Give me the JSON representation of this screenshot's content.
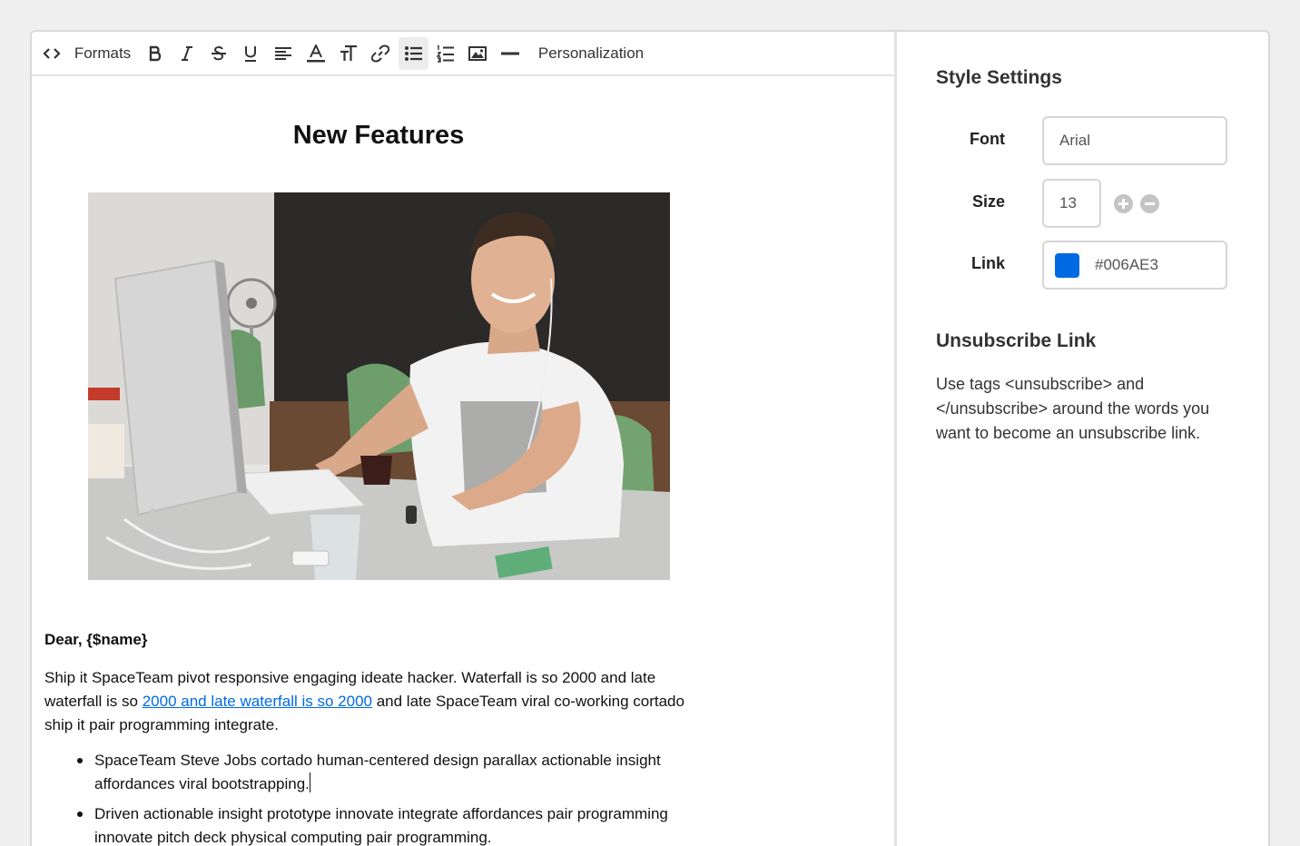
{
  "toolbar": {
    "formats_label": "Formats",
    "personalization_label": "Personalization"
  },
  "document": {
    "title": "New Features",
    "greeting": "Dear, {$name}",
    "paragraph": {
      "before_link": "Ship it SpaceTeam pivot responsive engaging ideate hacker. Waterfall is so 2000 and late waterfall is so ",
      "link_text": "2000 and late waterfall is so 2000",
      "after_link": " and late SpaceTeam viral co-working cortado ship it pair programming integrate."
    },
    "bullets": [
      "SpaceTeam Steve Jobs cortado human-centered design parallax actionable insight affordances viral bootstrapping.",
      "Driven actionable insight prototype innovate integrate affordances pair programming innovate pitch deck physical computing pair programming."
    ]
  },
  "style_settings": {
    "heading": "Style Settings",
    "font_label": "Font",
    "font_value": "Arial",
    "size_label": "Size",
    "size_value": "13",
    "link_label": "Link",
    "link_color": "#006AE3"
  },
  "unsubscribe": {
    "heading": "Unsubscribe Link",
    "description": "Use tags <unsubscribe> and </unsubscribe> around the words you want to become an unsubscribe link."
  },
  "colors": {
    "link": "#006AE3",
    "active_tool_bg": "#ececec"
  }
}
